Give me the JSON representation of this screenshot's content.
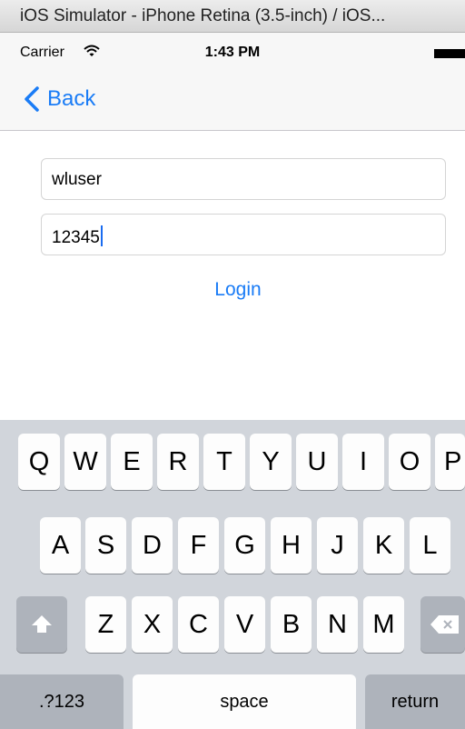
{
  "window": {
    "title": "iOS Simulator - iPhone Retina (3.5-inch) / iOS..."
  },
  "status_bar": {
    "carrier": "Carrier",
    "time": "1:43 PM"
  },
  "nav": {
    "back_label": "Back"
  },
  "form": {
    "username_value": "wluser",
    "password_value": "12345",
    "login_label": "Login"
  },
  "keyboard": {
    "row1": [
      "Q",
      "W",
      "E",
      "R",
      "T",
      "Y",
      "U",
      "I",
      "O",
      "P"
    ],
    "row2": [
      "A",
      "S",
      "D",
      "F",
      "G",
      "H",
      "J",
      "K",
      "L"
    ],
    "row3": [
      "Z",
      "X",
      "C",
      "V",
      "B",
      "N",
      "M"
    ],
    "numbers_label": ".?123",
    "space_label": "space",
    "return_label": "return"
  },
  "colors": {
    "accent": "#1a7cf6",
    "keyboard_bg": "#d1d5db",
    "dark_key": "#aeb3bb"
  }
}
